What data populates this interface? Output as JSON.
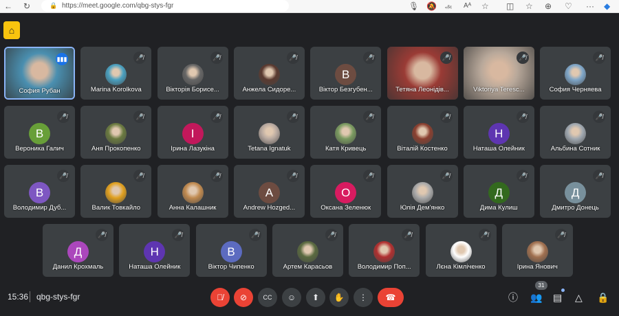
{
  "browser": {
    "url": "https://meet.google.com/qbg-stys-fgr"
  },
  "participants": [
    {
      "name": "София Рубан",
      "type": "video",
      "color": "#4a8fb0",
      "speaking": true
    },
    {
      "name": "Marina Korolkova",
      "type": "photo",
      "color": "#4aa0c0"
    },
    {
      "name": "Вікторія Борисе...",
      "type": "photo",
      "color": "#666666"
    },
    {
      "name": "Анжела Сидоре...",
      "type": "photo",
      "color": "#5a3a30"
    },
    {
      "name": "Віктор Безгубен...",
      "type": "letter",
      "letter": "В",
      "color": "#6d4c41"
    },
    {
      "name": "Тетяна Леонідів...",
      "type": "video",
      "color": "#9a3b35"
    },
    {
      "name": "Viktoriya Teresc...",
      "type": "video",
      "color": "#b8a89a"
    },
    {
      "name": "София Черняева",
      "type": "photo",
      "color": "#7fa6c8"
    },
    {
      "name": "Вероника Галич",
      "type": "letter",
      "letter": "В",
      "color": "#689f38"
    },
    {
      "name": "Аня Прокопенко",
      "type": "photo",
      "color": "#6a7a40"
    },
    {
      "name": "Ірина Лазукіна",
      "type": "letter",
      "letter": "І",
      "color": "#c2185b"
    },
    {
      "name": "Tetana Ignatuk",
      "type": "photo",
      "color": "#b8a9a0"
    },
    {
      "name": "Катя Кривець",
      "type": "photo",
      "color": "#7a9a60"
    },
    {
      "name": "Віталій Костенко",
      "type": "photo",
      "color": "#8a4030"
    },
    {
      "name": "Наташа Олейник",
      "type": "letter",
      "letter": "Н",
      "color": "#5e35b1"
    },
    {
      "name": "Альбина Сотник",
      "type": "photo",
      "color": "#a0a8b0"
    },
    {
      "name": "Володимир Дуб...",
      "type": "letter",
      "letter": "В",
      "color": "#7e57c2"
    },
    {
      "name": "Валик Товкайло",
      "type": "photo",
      "color": "#e0a020"
    },
    {
      "name": "Анна Калашник",
      "type": "photo",
      "color": "#c08a50"
    },
    {
      "name": "Andrew Hozged...",
      "type": "letter",
      "letter": "A",
      "color": "#6d4c41"
    },
    {
      "name": "Оксана Зеленюк",
      "type": "letter",
      "letter": "О",
      "color": "#d81b60"
    },
    {
      "name": "Юлія Дем'янко",
      "type": "photo",
      "color": "#aaaaaa"
    },
    {
      "name": "Дима Кулиш",
      "type": "letter",
      "letter": "Д",
      "color": "#33691e"
    },
    {
      "name": "Дмитро Донець",
      "type": "letter",
      "letter": "Д",
      "color": "#78909c"
    },
    {
      "name": "Данил Крохмаль",
      "type": "letter",
      "letter": "Д",
      "color": "#ab47bc"
    },
    {
      "name": "Наташа Олейник",
      "type": "letter",
      "letter": "Н",
      "color": "#5e35b1"
    },
    {
      "name": "Віктор Чипенко",
      "type": "letter",
      "letter": "В",
      "color": "#5c6bc0"
    },
    {
      "name": "Артем Карасьов",
      "type": "photo",
      "color": "#5a6a40"
    },
    {
      "name": "Володимир Поп...",
      "type": "photo",
      "color": "#b03030"
    },
    {
      "name": "Лєна Кімліченко",
      "type": "photo",
      "color": "#ffffff"
    },
    {
      "name": "Ірина Янович",
      "type": "photo",
      "color": "#a07050"
    }
  ],
  "meeting": {
    "time": "15:36",
    "code": "qbg-stys-fgr",
    "participant_count": "31"
  }
}
